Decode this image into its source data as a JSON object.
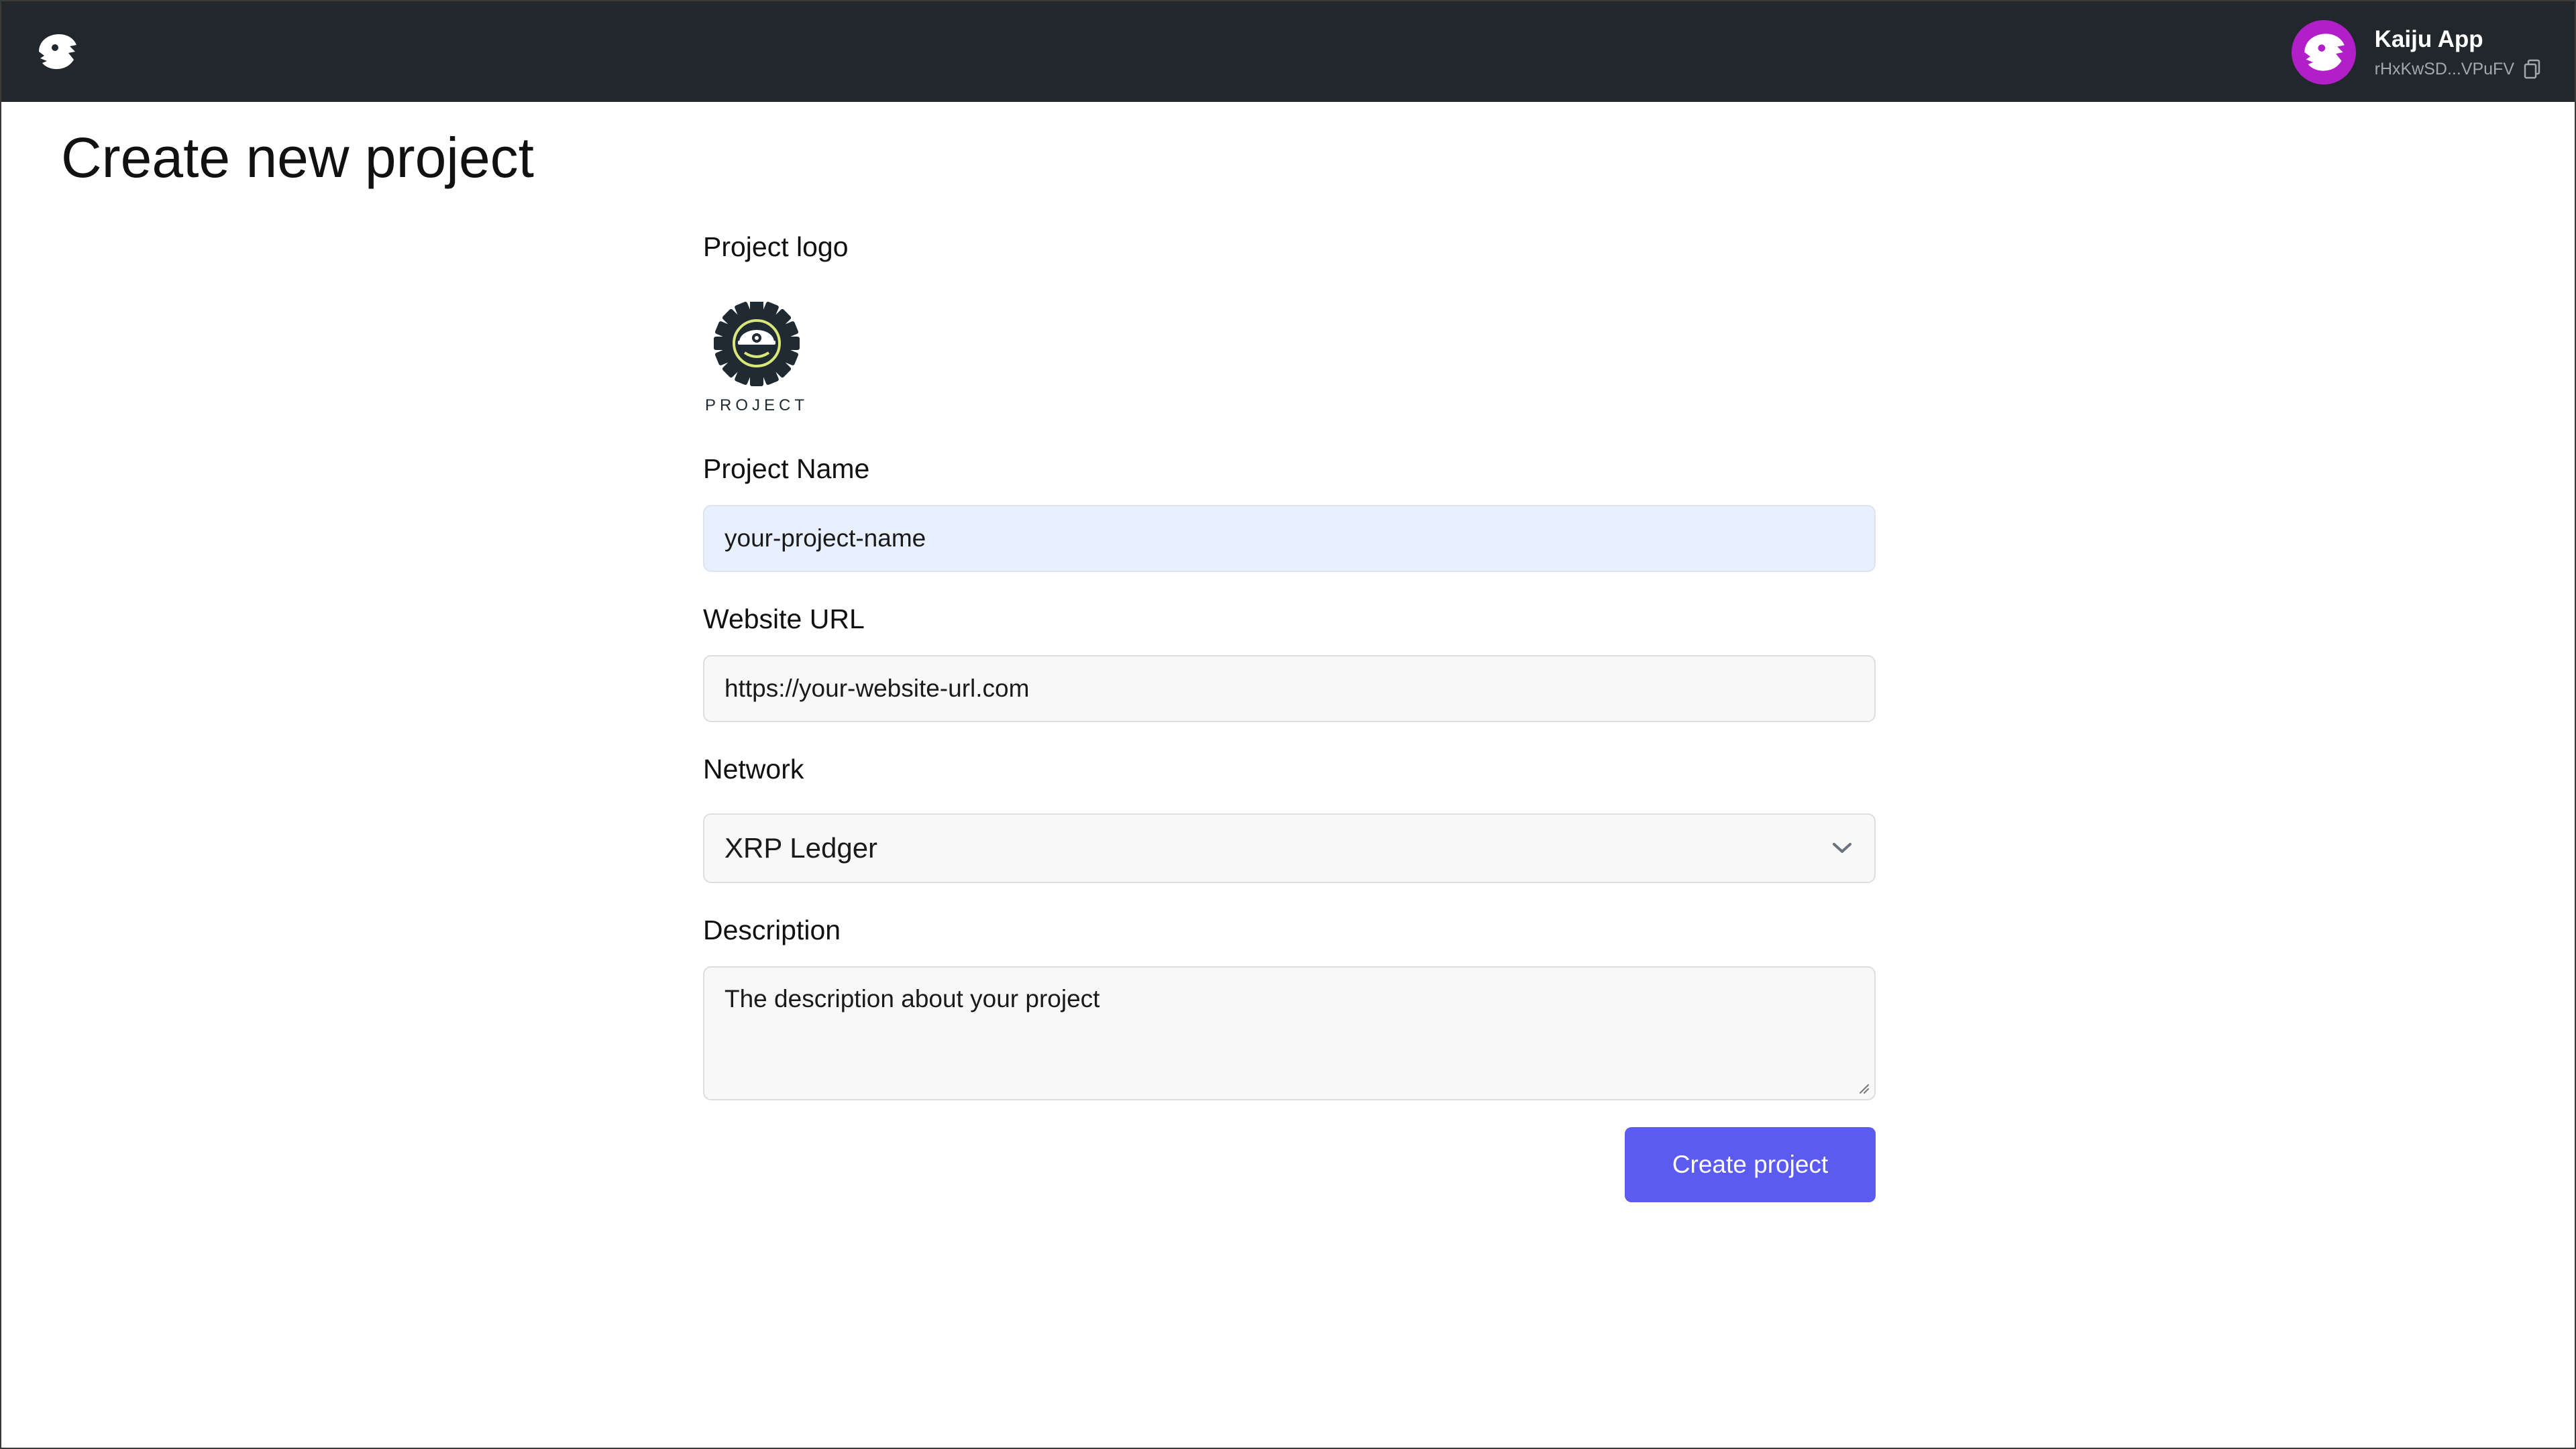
{
  "header": {
    "user_name": "Kaiju App",
    "user_address": "rHxKwSD...VPuFV",
    "avatar_color": "#b11fc8",
    "bar_color": "#22272b"
  },
  "page": {
    "title": "Create new project"
  },
  "form": {
    "logo_label": "Project logo",
    "logo_text": "PROJECT",
    "name_label": "Project Name",
    "name_value": "your-project-name",
    "website_label": "Website URL",
    "website_value": "https://your-website-url.com",
    "network_label": "Network",
    "network_selected": "XRP Ledger",
    "description_label": "Description",
    "description_value": "The description about your project",
    "submit_label": "Create project",
    "submit_color": "#5b5bf0"
  },
  "icons": {
    "brand": "kaiju-logo-icon",
    "copy": "copy-icon",
    "chevron": "chevron-down-icon",
    "project_logo": "gear-logo-icon"
  }
}
